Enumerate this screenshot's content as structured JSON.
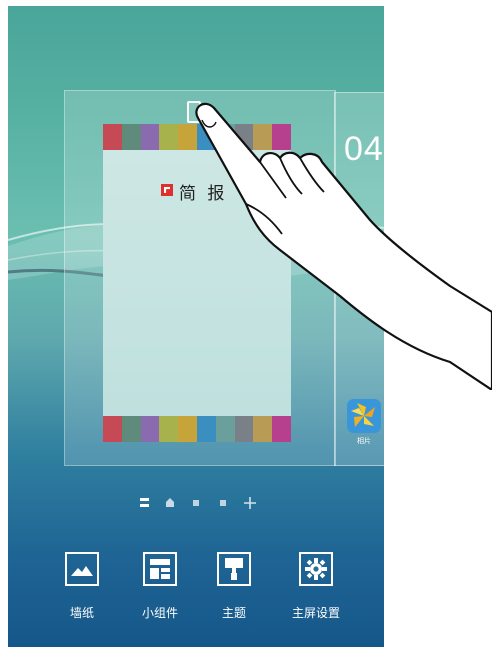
{
  "home_edit": {
    "widget": {
      "title": "简 报",
      "app_name": "Flipboard",
      "stripe_colors": [
        "#c64a55",
        "#5f8b7c",
        "#8a6bb0",
        "#a7b24c",
        "#c7a43a",
        "#3b8fc0",
        "#6a9f9c",
        "#7a8088",
        "#b89c56",
        "#b7408e"
      ]
    },
    "next_page": {
      "clock_text": "04",
      "app_label": "相片"
    },
    "page_indicator": {
      "items": [
        "home",
        "page",
        "page",
        "page",
        "add"
      ],
      "current_index": 0
    },
    "toolbar": {
      "items": [
        {
          "label": "墙纸",
          "icon": "wallpaper-icon"
        },
        {
          "label": "小组件",
          "icon": "widgets-icon"
        },
        {
          "label": "主题",
          "icon": "theme-icon"
        },
        {
          "label": "主屏设置",
          "icon": "settings-gear-icon"
        }
      ]
    },
    "colors": {
      "accent_red": "#e0302c",
      "text_light": "#ffffff"
    }
  }
}
